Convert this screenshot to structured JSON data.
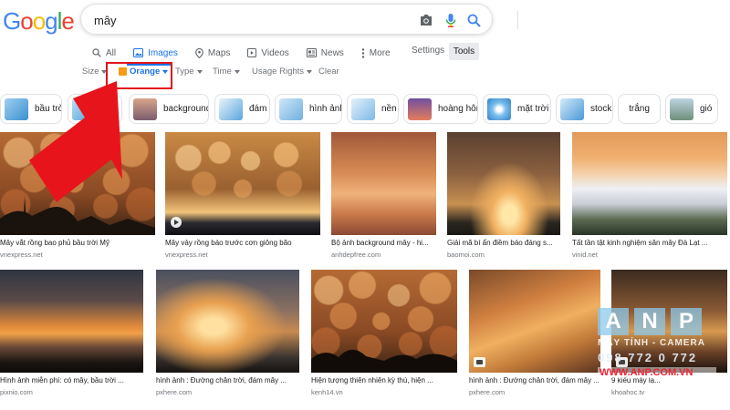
{
  "logo": {
    "text": "Google"
  },
  "search": {
    "query": "mây",
    "icons": [
      "camera-icon",
      "microphone-icon",
      "search-icon"
    ]
  },
  "tabs": [
    {
      "label": "All",
      "icon": "search-icon",
      "active": false
    },
    {
      "label": "Images",
      "icon": "image-icon",
      "active": true
    },
    {
      "label": "Maps",
      "icon": "map-pin-icon",
      "active": false
    },
    {
      "label": "Videos",
      "icon": "video-icon",
      "active": false
    },
    {
      "label": "News",
      "icon": "news-icon",
      "active": false
    },
    {
      "label": "More",
      "icon": "more-dots-icon",
      "active": false
    }
  ],
  "settings_label": "Settings",
  "tools_label": "Tools",
  "filters": {
    "size": "Size",
    "color": "Orange",
    "color_swatch": "#f69b12",
    "type": "Type",
    "time": "Time",
    "usage_rights": "Usage Rights",
    "clear": "Clear"
  },
  "chips": [
    {
      "label": "bầu trời"
    },
    {
      "label": "n"
    },
    {
      "label": "background"
    },
    {
      "label": "đám"
    },
    {
      "label": "hình ảnh"
    },
    {
      "label": "nền"
    },
    {
      "label": "hoàng hôn"
    },
    {
      "label": "mặt trời"
    },
    {
      "label": "stock"
    },
    {
      "label": "trắng"
    },
    {
      "label": "gió"
    }
  ],
  "results_row1": [
    {
      "caption": "Mây vắt rồng bao phủ bầu trời Mỹ",
      "source": "vnexpress.net"
    },
    {
      "caption": "Mây vảy rồng báo trước cơn giông bão",
      "source": "vnexpress.net"
    },
    {
      "caption": "Bộ ảnh background mây - hi...",
      "source": "anhdepfree.com"
    },
    {
      "caption": "Giải mã bí ẩn điềm báo đáng s...",
      "source": "baomoi.com"
    },
    {
      "caption": "Tất tần tật kinh nghiệm săn mây Đà Lạt ...",
      "source": "vinid.net"
    }
  ],
  "results_row2": [
    {
      "caption": "Hình ảnh miễn phí: có mây, bầu trời ...",
      "source": "pixnio.com"
    },
    {
      "caption": "hình ảnh : Đường chân trời, đám mây ...",
      "source": "pxhere.com"
    },
    {
      "caption": "Hiện tượng thiên nhiên kỳ thú, hiện ...",
      "source": "kenh14.vn"
    },
    {
      "caption": "hình ảnh : Đường chân trời, đám mây ...",
      "source": "pxhere.com"
    },
    {
      "caption": "9 kiểu mây lạ...",
      "source": "khoahoc.tv"
    }
  ],
  "watermark": {
    "letters": [
      "A",
      "N",
      "P"
    ],
    "line1": "MÁY TÍNH - CAMERA",
    "line2": "098 772 0 772",
    "line3": "WWW.ANP.COM.VN"
  },
  "annotation": {
    "arrow_color": "#e8141c",
    "box_color": "#e1141b"
  }
}
